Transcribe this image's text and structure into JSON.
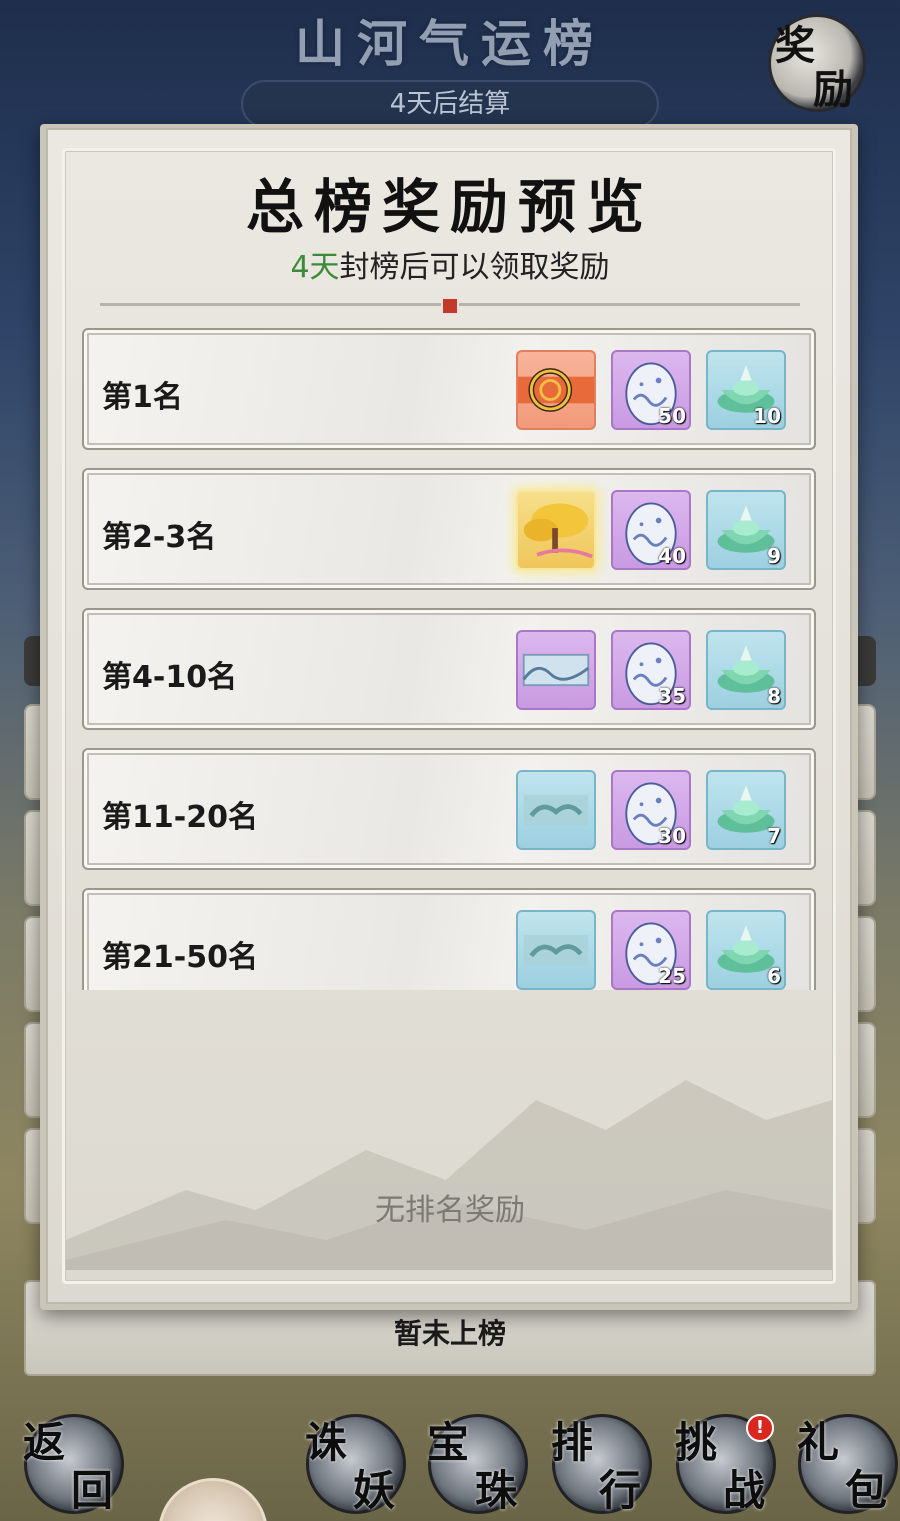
{
  "header": {
    "title": "山河气运榜",
    "countdown": "4天后结算",
    "reward_button": {
      "c1": "奖",
      "c2": "励"
    }
  },
  "popup": {
    "title": "总榜奖励预览",
    "subtitle_highlight": "4天",
    "subtitle_rest": "封榜后可以领取奖励",
    "no_rank_text": "无排名奖励",
    "rows": [
      {
        "label": "第1名",
        "items": [
          {
            "icon": "swirl-token-icon",
            "rarity": "orange",
            "qty": ""
          },
          {
            "icon": "spirit-egg-icon",
            "rarity": "purple",
            "qty": "50"
          },
          {
            "icon": "jade-cauldron-icon",
            "rarity": "cyan",
            "qty": "10"
          }
        ]
      },
      {
        "label": "第2-3名",
        "items": [
          {
            "icon": "golden-tree-icon",
            "rarity": "gold",
            "qty": ""
          },
          {
            "icon": "spirit-egg-icon",
            "rarity": "purple",
            "qty": "40"
          },
          {
            "icon": "jade-cauldron-icon",
            "rarity": "cyan",
            "qty": "9"
          }
        ]
      },
      {
        "label": "第4-10名",
        "items": [
          {
            "icon": "wave-frame-icon",
            "rarity": "purple",
            "qty": ""
          },
          {
            "icon": "spirit-egg-icon",
            "rarity": "purple",
            "qty": "35"
          },
          {
            "icon": "jade-cauldron-icon",
            "rarity": "cyan",
            "qty": "8"
          }
        ]
      },
      {
        "label": "第11-20名",
        "items": [
          {
            "icon": "cloud-frame-icon",
            "rarity": "cyan",
            "qty": ""
          },
          {
            "icon": "spirit-egg-icon",
            "rarity": "purple",
            "qty": "30"
          },
          {
            "icon": "jade-cauldron-icon",
            "rarity": "cyan",
            "qty": "7"
          }
        ]
      },
      {
        "label": "第21-50名",
        "items": [
          {
            "icon": "cloud-frame-icon",
            "rarity": "cyan",
            "qty": ""
          },
          {
            "icon": "spirit-egg-icon",
            "rarity": "purple",
            "qty": "25"
          },
          {
            "icon": "jade-cauldron-icon",
            "rarity": "cyan",
            "qty": "6"
          }
        ]
      }
    ]
  },
  "unranked": "暂未上榜",
  "nav": [
    {
      "id": "back",
      "c1": "返",
      "c2": "回"
    },
    {
      "id": "demon",
      "c1": "诛",
      "c2": "妖"
    },
    {
      "id": "pearl",
      "c1": "宝",
      "c2": "珠"
    },
    {
      "id": "rank",
      "c1": "排",
      "c2": "行"
    },
    {
      "id": "challenge",
      "c1": "挑",
      "c2": "战",
      "badge": "!"
    },
    {
      "id": "gift",
      "c1": "礼",
      "c2": "包"
    }
  ],
  "colors": {
    "highlight_green": "#3c8a3a",
    "badge_red": "#d9261f"
  }
}
